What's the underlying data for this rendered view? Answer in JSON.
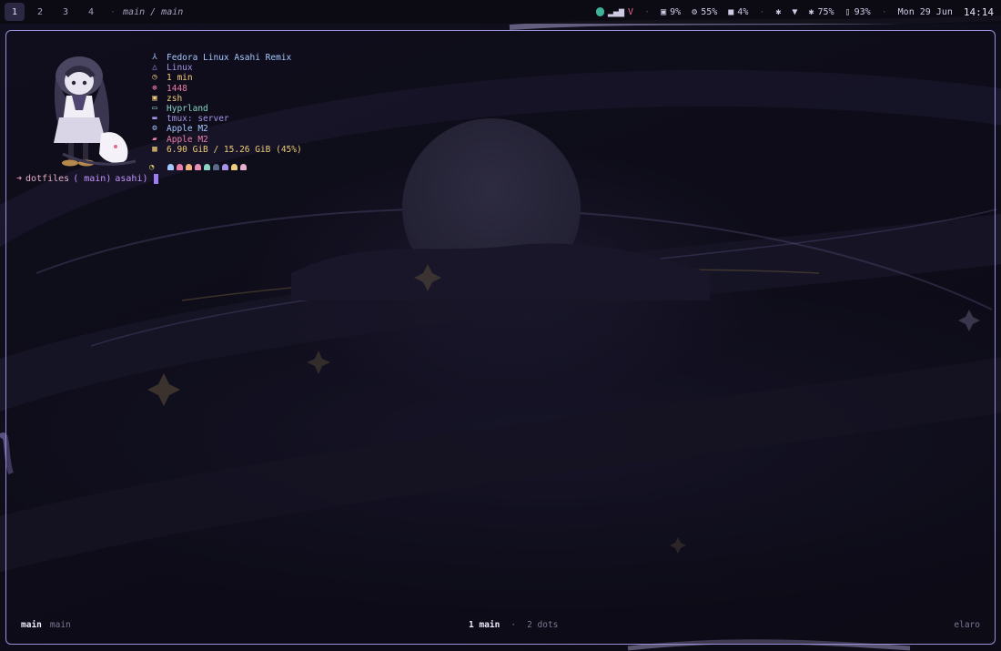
{
  "workspaces": [
    "1",
    "2",
    "3",
    "4"
  ],
  "active_workspace": "1",
  "breadcrumb": "main / main",
  "tray": {
    "disk": "9%",
    "cpu": "55%",
    "mem": "4%",
    "battery": "75%",
    "battery2": "93%",
    "date": "Mon 29 Jun",
    "time": "14:14"
  },
  "fetch": [
    {
      "icon": "fedora-icon",
      "glyph": "⅄",
      "color": "#a6c8ff",
      "value": "Fedora Linux Asahi Remix"
    },
    {
      "icon": "linux-icon",
      "glyph": "△",
      "color": "#a592e8",
      "value": "Linux"
    },
    {
      "icon": "clock-icon",
      "glyph": "◷",
      "color": "#f0cd7a",
      "value": "1 min"
    },
    {
      "icon": "package-icon",
      "glyph": "⊛",
      "color": "#ec7fa9",
      "value": "1448"
    },
    {
      "icon": "shell-icon",
      "glyph": "▣",
      "color": "#f0cd7a",
      "value": "zsh"
    },
    {
      "icon": "window-icon",
      "glyph": "▭",
      "color": "#8ad6c6",
      "value": "Hyprland"
    },
    {
      "icon": "terminal-icon",
      "glyph": "▬",
      "color": "#a592e8",
      "value": "tmux: server"
    },
    {
      "icon": "cpu-icon",
      "glyph": "⚙",
      "color": "#a6c8ff",
      "value": "Apple M2"
    },
    {
      "icon": "gpu-icon",
      "glyph": "▰",
      "color": "#ec7fa9",
      "value": "Apple M2"
    },
    {
      "icon": "memory-icon",
      "glyph": "▦",
      "color": "#f0cd7a",
      "value": "6.90 GiB / 15.26 GiB (45%)"
    }
  ],
  "ghost_colors": [
    "#a6c8ff",
    "#ec7fa9",
    "#f0b27a",
    "#e98fb6",
    "#8ad6c6",
    "#5b6888",
    "#a592e8",
    "#f0cd7a",
    "#e6b0cb"
  ],
  "prompt": {
    "arrow": "➜",
    "dir": "dotfiles",
    "branch": "( main)",
    "host": "asahi)"
  },
  "status": {
    "left_session": "main",
    "left_window": "main",
    "center_active": "1 main",
    "center_other": "2 dots",
    "right_host": "elaro"
  },
  "colors": {
    "accent": "#9b8fd9",
    "background": "#0d0c17"
  }
}
